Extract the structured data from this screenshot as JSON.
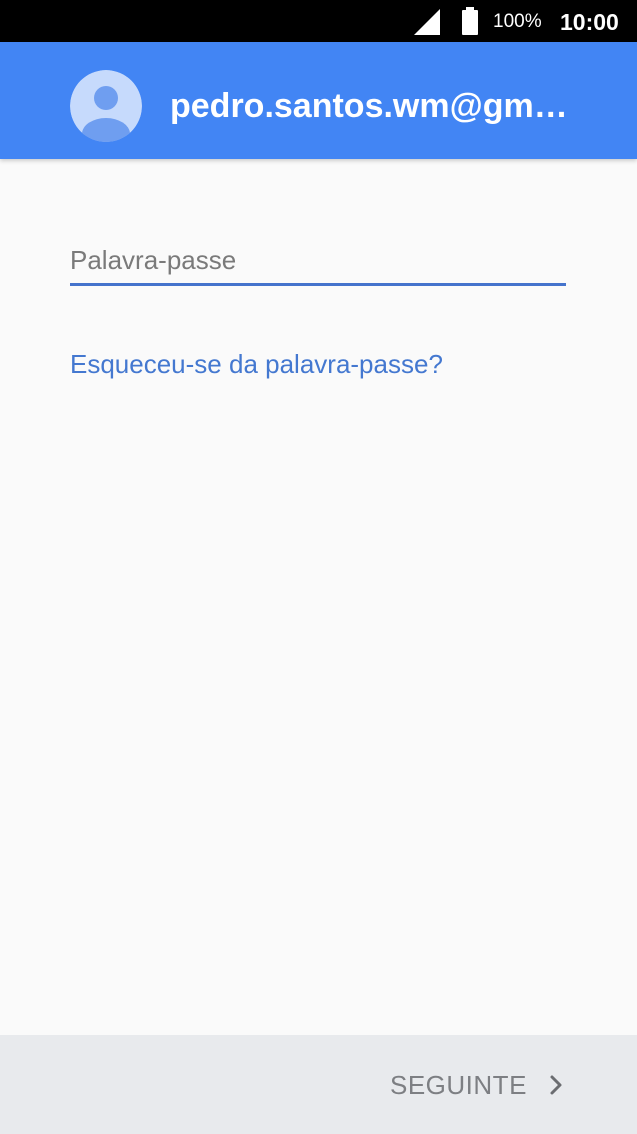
{
  "status_bar": {
    "battery_level": "100%",
    "time": "10:00",
    "icons": [
      "signal-icon",
      "battery-icon"
    ]
  },
  "header": {
    "account_email": "pedro.santos.wm@gmail.com",
    "avatar_icon": "account-avatar-icon",
    "background_color": "#4285f4"
  },
  "password": {
    "placeholder": "Palavra-passe",
    "value": ""
  },
  "forgot_password_link": "Esqueceu-se da palavra-passe?",
  "footer": {
    "next_label": "SEGUINTE",
    "next_icon": "chevron-right-icon"
  },
  "colors": {
    "accent": "#4285f4",
    "link": "#4478d0",
    "underline": "#4573cc",
    "footer_background": "#e8eaed"
  }
}
